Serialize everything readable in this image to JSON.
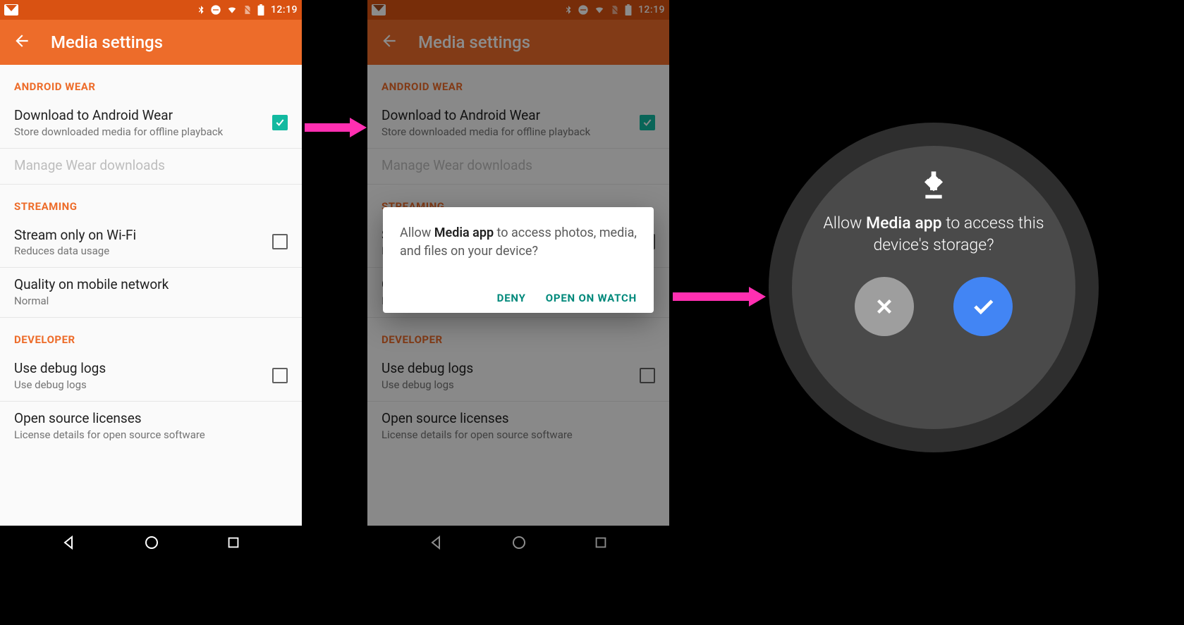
{
  "status": {
    "time": "12:19"
  },
  "appbar": {
    "title": "Media settings"
  },
  "sections": {
    "wear_header": "ANDROID WEAR",
    "download_wear": {
      "title": "Download to Android Wear",
      "sub": "Store downloaded media for offline playback",
      "checked": true
    },
    "manage_wear": {
      "title": "Manage Wear downloads"
    },
    "streaming_header": "STREAMING",
    "stream_wifi": {
      "title": "Stream only on Wi-Fi",
      "sub": "Reduces data usage",
      "checked": false
    },
    "quality": {
      "title": "Quality on mobile network",
      "sub": "Normal"
    },
    "developer_header": "DEVELOPER",
    "debug": {
      "title": "Use debug logs",
      "sub": "Use debug logs",
      "checked": false
    },
    "licenses": {
      "title": "Open source licenses",
      "sub": "License details for open source software"
    }
  },
  "dialog": {
    "msg_pre": "Allow ",
    "msg_bold": "Media app",
    "msg_post": " to access photos, media, and files on your device?",
    "deny": "DENY",
    "open": "OPEN ON WATCH"
  },
  "watch": {
    "msg_pre": "Allow ",
    "msg_bold": "Media app",
    "msg_post": " to access this device's storage?"
  }
}
